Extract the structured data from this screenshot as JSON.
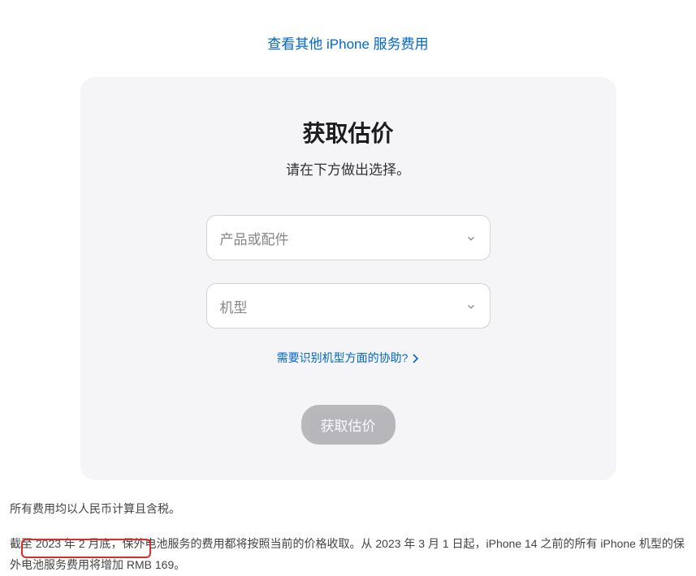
{
  "top_link": {
    "label": "查看其他 iPhone 服务费用"
  },
  "card": {
    "title": "获取估价",
    "subtitle": "请在下方做出选择。",
    "select1": {
      "placeholder": "产品或配件"
    },
    "select2": {
      "placeholder": "机型"
    },
    "help_link": {
      "label": "需要识别机型方面的协助?"
    },
    "submit": {
      "label": "获取估价"
    }
  },
  "footer": {
    "line1": "所有费用均以人民币计算且含税。",
    "line2": "截至 2023 年 2 月底，保外电池服务的费用都将按照当前的价格收取。从 2023 年 3 月 1 日起，iPhone 14 之前的所有 iPhone 机型的保外电池服务费用将增加 RMB 169。"
  }
}
